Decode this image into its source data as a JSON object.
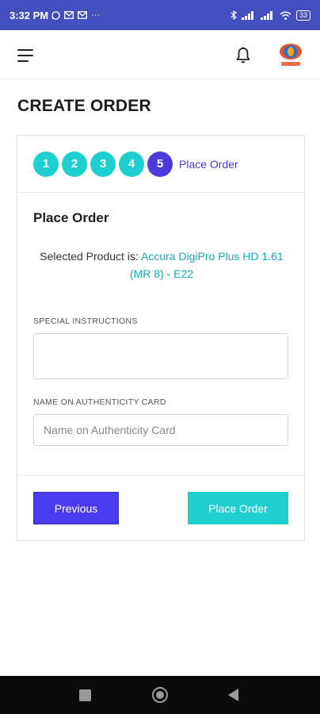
{
  "status_bar": {
    "time": "3:32 PM",
    "notification_icons": [
      "whatsapp-icon",
      "mail-icon",
      "mail-icon"
    ],
    "more": "···",
    "battery": "33"
  },
  "page": {
    "title": "CREATE ORDER"
  },
  "stepper": {
    "steps": [
      "1",
      "2",
      "3",
      "4",
      "5"
    ],
    "active_step": "5",
    "active_label": "Place Order"
  },
  "form": {
    "section_title": "Place Order",
    "selected_prefix": "Selected Product is:",
    "selected_product": "Accura DigiPro Plus HD 1.61 (MR 8) - E22",
    "instructions_label": "SPECIAL INSTRUCTIONS",
    "instructions_value": "",
    "name_label": "NAME ON AUTHENTICITY CARD",
    "name_placeholder": "Name on Authenticity Card"
  },
  "buttons": {
    "previous": "Previous",
    "place_order": "Place Order"
  },
  "colors": {
    "status_bar": "#4250bd",
    "step_done": "#1fcfcf",
    "step_active": "#4b3bdf",
    "product_link": "#1ba7b5",
    "previous_button": "#4b3bf0",
    "place_button": "#1fcfcf"
  }
}
